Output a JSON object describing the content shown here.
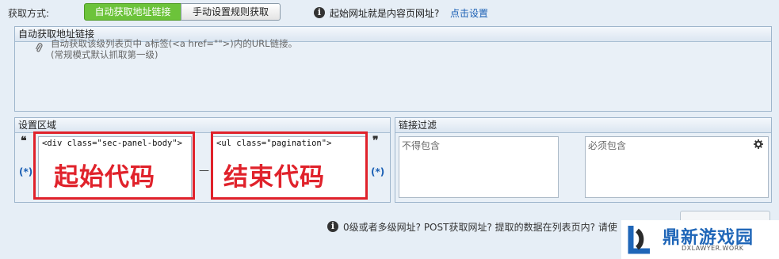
{
  "toolbar": {
    "mode_label": "获取方式:",
    "tab_auto": "自动获取地址链接",
    "tab_manual": "手动设置规则获取",
    "hint_text": "起始网址就是内容页网址?",
    "hint_link": "点击设置"
  },
  "auto_panel": {
    "title": "自动获取地址链接",
    "desc_line1": "自动获取该级列表页中 a标签(<a href=\"\">)内的URL链接。",
    "desc_line2": "(常规模式默认抓取第一级)"
  },
  "setting_panel": {
    "title": "设置区域",
    "open_quote": "❝",
    "close_quote": "❞",
    "star_left": "(*)",
    "star_right": "(*)",
    "start_code": "<div class=\"sec-panel-body\">",
    "end_code": "<ul class=\"pagination\">",
    "start_label": "起始代码",
    "end_label": "结束代码",
    "dash": "—"
  },
  "filter_panel": {
    "title": "链接过滤",
    "exclude_placeholder": "不得包含",
    "include_placeholder": "必须包含"
  },
  "bottom": {
    "text": "0级或者多级网址? POST获取网址? 提取的数据在列表页内? 请使"
  },
  "watermark": {
    "name": "鼎新游戏园",
    "sub": "DXLAWYER.WORK"
  },
  "colors": {
    "accent_green": "#6cc33a",
    "annotation_red": "#e0222b",
    "link_blue": "#1a5fb4"
  }
}
